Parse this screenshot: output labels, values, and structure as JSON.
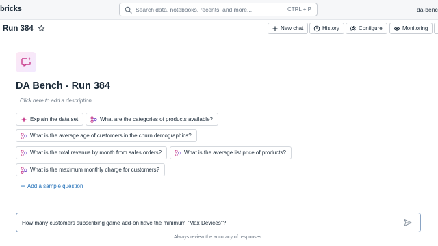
{
  "topbar": {
    "brand": "bricks",
    "search_placeholder": "Search data, notebooks, recents, and more...",
    "search_shortcut": "CTRL + P",
    "user": "da-bench"
  },
  "header": {
    "title": "Run 384",
    "buttons": {
      "new_chat": "New chat",
      "history": "History",
      "configure": "Configure",
      "monitoring": "Monitoring"
    }
  },
  "space": {
    "title": "DA Bench - Run 384",
    "description_placeholder": "Click here to add a description"
  },
  "samples": [
    {
      "label": "Explain the data set",
      "icon": "sparkle-icon"
    },
    {
      "label": "What are the categories of products available?",
      "icon": "sql-flow-icon"
    },
    {
      "label": "What is the average age of customers in the churn demographics?",
      "icon": "sql-flow-icon"
    },
    {
      "label": "What is the total revenue by month from sales orders?",
      "icon": "sql-flow-icon"
    },
    {
      "label": "What is the average list price of products?",
      "icon": "sql-flow-icon"
    },
    {
      "label": "What is the maximum monthly charge for customers?",
      "icon": "sql-flow-icon"
    }
  ],
  "add_sample": "Add a sample question",
  "composer": {
    "value": "How many customers subscribing game add-on have the minimum \"Max Devices\"?"
  },
  "disclaimer": "Always review the accuracy of responses.",
  "colors": {
    "accent": "#2270b8",
    "icon_pink": "#c73a8a",
    "border_focus": "#8aa4c4"
  }
}
